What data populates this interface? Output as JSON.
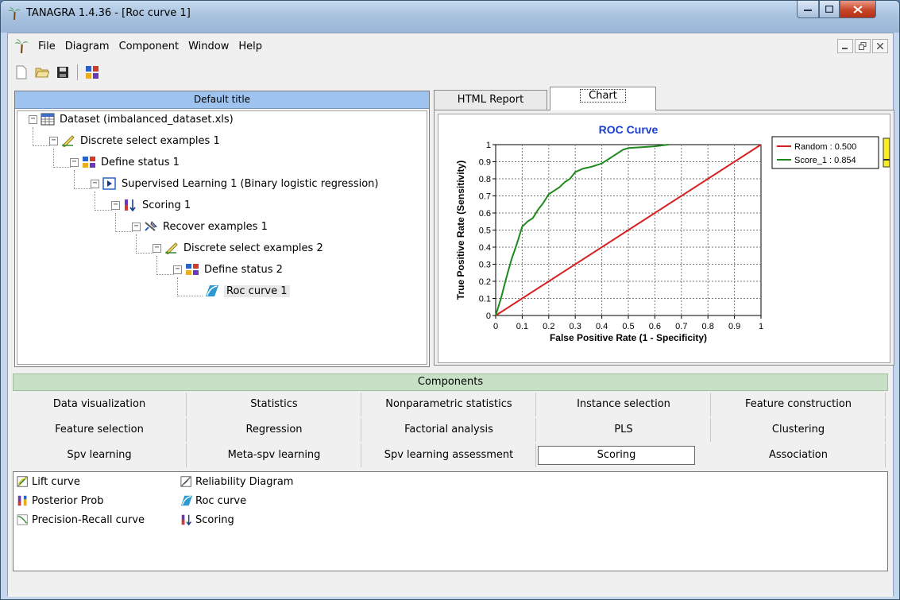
{
  "window": {
    "title": "TANAGRA 1.4.36 - [Roc curve 1]"
  },
  "menu": {
    "items": [
      "File",
      "Diagram",
      "Component",
      "Window",
      "Help"
    ]
  },
  "icons": {
    "app": "palm-tree-icon",
    "new": "new-document-icon",
    "open": "open-folder-icon",
    "save": "floppy-disk-icon",
    "component": "component-grid-icon"
  },
  "diagram": {
    "title": "Default title",
    "nodes": [
      {
        "label": "Dataset (imbalanced_dataset.xls)",
        "icon": "table-icon"
      },
      {
        "label": "Discrete select examples 1",
        "icon": "pencil-select-icon"
      },
      {
        "label": "Define status 1",
        "icon": "define-status-icon"
      },
      {
        "label": "Supervised Learning 1 (Binary logistic regression)",
        "icon": "play-learning-icon"
      },
      {
        "label": "Scoring 1",
        "icon": "scoring-icon"
      },
      {
        "label": "Recover examples 1",
        "icon": "recover-icon"
      },
      {
        "label": "Discrete select examples 2",
        "icon": "pencil-select-icon"
      },
      {
        "label": "Define status 2",
        "icon": "define-status-icon"
      },
      {
        "label": "Roc curve 1",
        "icon": "roc-curve-icon"
      }
    ]
  },
  "tabs": {
    "html_report": "HTML Report",
    "chart": "Chart"
  },
  "chart_data": {
    "type": "line",
    "title": "ROC Curve",
    "xlabel": "False Positive Rate (1 - Specificity)",
    "ylabel": "True Positive Rate (Sensitivity)",
    "xlim": [
      0,
      1
    ],
    "ylim": [
      0,
      1
    ],
    "xticks": [
      "0",
      "0.1",
      "0.2",
      "0.3",
      "0.4",
      "0.5",
      "0.6",
      "0.7",
      "0.8",
      "0.9",
      "1"
    ],
    "yticks": [
      "0",
      "0.1",
      "0.2",
      "0.3",
      "0.4",
      "0.5",
      "0.6",
      "0.7",
      "0.8",
      "0.9",
      "1"
    ],
    "grid": true,
    "legend_position": "right",
    "series": [
      {
        "name": "Random : 0.500",
        "color": "#d62020",
        "x": [
          0,
          1
        ],
        "y": [
          0,
          1
        ]
      },
      {
        "name": "Score_1 : 0.854",
        "color": "#1e8a1e",
        "x": [
          0,
          0.02,
          0.04,
          0.06,
          0.08,
          0.1,
          0.12,
          0.14,
          0.16,
          0.18,
          0.2,
          0.22,
          0.24,
          0.26,
          0.28,
          0.3,
          0.33,
          0.36,
          0.38,
          0.4,
          0.42,
          0.44,
          0.46,
          0.48,
          0.5,
          0.55,
          0.6,
          0.65
        ],
        "y": [
          0,
          0.1,
          0.22,
          0.33,
          0.42,
          0.52,
          0.55,
          0.57,
          0.62,
          0.66,
          0.71,
          0.73,
          0.75,
          0.78,
          0.8,
          0.84,
          0.86,
          0.87,
          0.88,
          0.89,
          0.91,
          0.93,
          0.95,
          0.97,
          0.98,
          0.985,
          0.99,
          1.0
        ]
      }
    ]
  },
  "components": {
    "title": "Components",
    "rows": [
      [
        "Data visualization",
        "Statistics",
        "Nonparametric statistics",
        "Instance selection",
        "Feature construction"
      ],
      [
        "Feature selection",
        "Regression",
        "Factorial analysis",
        "PLS",
        "Clustering"
      ],
      [
        "Spv learning",
        "Meta-spv learning",
        "Spv learning assessment",
        "Scoring",
        "Association"
      ]
    ],
    "active": "Scoring",
    "items": [
      {
        "label": "Lift curve",
        "icon": "lift-curve-icon"
      },
      {
        "label": "Posterior Prob",
        "icon": "posterior-prob-icon"
      },
      {
        "label": "Precision-Recall curve",
        "icon": "precision-recall-icon"
      },
      {
        "label": "Reliability Diagram",
        "icon": "reliability-diagram-icon"
      },
      {
        "label": "Roc curve",
        "icon": "roc-curve-icon"
      },
      {
        "label": "Scoring",
        "icon": "scoring-icon"
      }
    ]
  }
}
